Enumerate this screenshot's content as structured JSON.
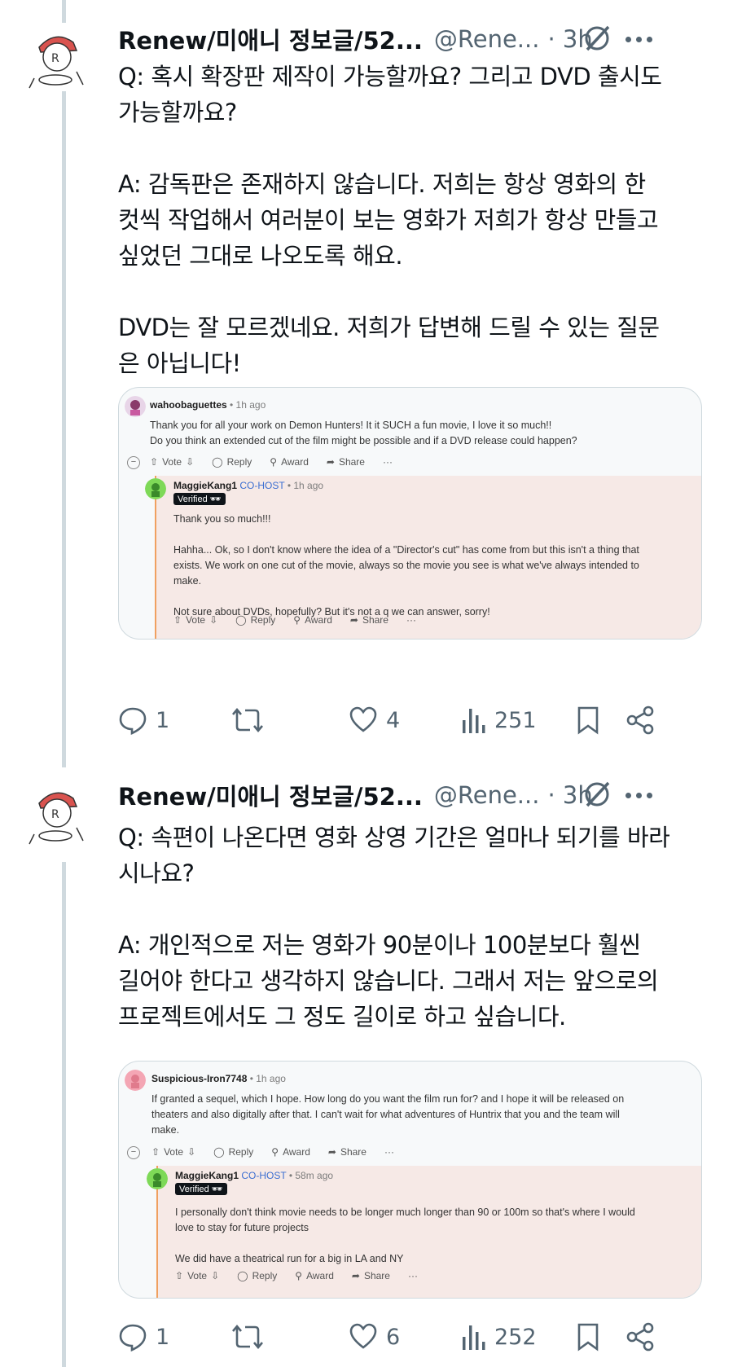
{
  "posts": [
    {
      "author_name": "Renew/미애니 정보글/52...",
      "handle": "@Rene...",
      "time": "· 3h",
      "body": "Q: 혹시 확장판 제작이 가능할까요? 그리고 DVD 출시도\n가능할까요?\n\nA: 감독판은 존재하지 않습니다. 저희는 항상 영화의 한\n컷씩 작업해서 여러분이 보는 영화가 저희가 항상 만들고\n싶었던 그대로 나오도록 해요.\n\nDVD는 잘 모르겠네요. 저희가 답변해 드릴 수 있는 질문\n은 아닙니다!",
      "embed": {
        "comment_user": "wahoobaguettes",
        "comment_ago": " • 1h ago",
        "comment_text": "Thank you for all your work on Demon Hunters! It it SUCH a fun movie, I love it so much!!\nDo you think an extended cut of the film might be possible and if a DVD release could happen?",
        "reply_user": "MaggieKang1",
        "reply_role": "CO-HOST",
        "reply_ago": " • 1h ago",
        "reply_badge": "Verified 🕶",
        "reply_text": "Thank you so much!!!\n\nHahha... Ok, so I don't know where the idea of a \"Director's cut\" has come from but this isn't a thing that\nexists. We work on one cut of the movie, always so the movie you see is what we've always intended to\nmake.\n\nNot sure about DVDs, hopefully? But it's not a q we can answer, sorry!"
      },
      "stats": {
        "replies": "1",
        "likes": "4",
        "views": "251"
      }
    },
    {
      "author_name": "Renew/미애니 정보글/52...",
      "handle": "@Rene...",
      "time": "· 3h",
      "body": "Q: 속편이 나온다면 영화 상영 기간은 얼마나 되기를 바라\n시나요?\n\nA: 개인적으로 저는 영화가 90분이나 100분보다 훨씬\n길어야 한다고 생각하지 않습니다. 그래서 저는 앞으로의\n프로젝트에서도 그 정도 길이로 하고 싶습니다.",
      "embed": {
        "comment_user": "Suspicious-Iron7748",
        "comment_ago": " • 1h ago",
        "comment_text": "If granted a sequel, which I hope. How long do you want the film run for? and I hope it will be released on\ntheaters and also digitally after that. I can't wait for what adventures of Huntrix that you and the team will\nmake.",
        "reply_user": "MaggieKang1",
        "reply_role": "CO-HOST",
        "reply_ago": " • 58m ago",
        "reply_badge": "Verified 🕶",
        "reply_text": "I personally don't think movie needs to be longer much longer than 90 or 100m so that's where I would\nlove to stay for future projects\n\nWe did have a theatrical run for a big in LA and NY"
      },
      "stats": {
        "replies": "1",
        "likes": "6",
        "views": "252"
      }
    }
  ],
  "reddit_actions": {
    "vote": "Vote",
    "reply": "Reply",
    "award": "Award",
    "share": "Share",
    "more": "···"
  },
  "icons": {
    "reply": "comment-icon",
    "repost": "repost-icon",
    "like": "heart-icon",
    "views": "analytics-icon",
    "bookmark": "bookmark-icon",
    "share": "share-icon",
    "grok": "grok-icon",
    "more": "more-icon"
  },
  "colors": {
    "text": "#0f1419",
    "secondary": "#536471",
    "thread_line": "#cfd9de",
    "cohost": "#3b6ed1",
    "reply_bg": "#f6e9e6"
  }
}
